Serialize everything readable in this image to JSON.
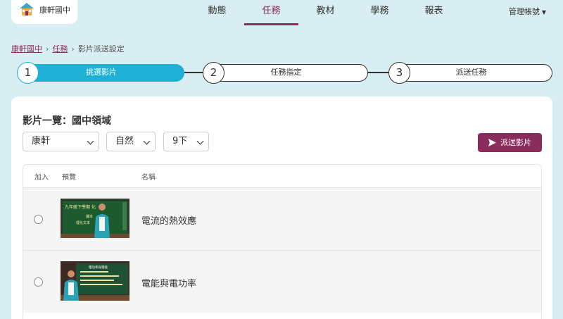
{
  "header": {
    "logo_text": "康軒國中",
    "nav": [
      {
        "label": "動態",
        "active": false
      },
      {
        "label": "任務",
        "active": true
      },
      {
        "label": "教材",
        "active": false
      },
      {
        "label": "學務",
        "active": false
      },
      {
        "label": "報表",
        "active": false
      }
    ],
    "account_label": "管理帳號"
  },
  "breadcrumb": {
    "items": [
      "康軒國中",
      "任務",
      "影片派送設定"
    ]
  },
  "steps": [
    {
      "number": "1",
      "label": "挑選影片",
      "active": true
    },
    {
      "number": "2",
      "label": "任務指定",
      "active": false
    },
    {
      "number": "3",
      "label": "派送任務",
      "active": false
    }
  ],
  "card": {
    "title": "影片一覽：國中領域",
    "filters": {
      "publisher": "康軒",
      "subject": "自然",
      "grade": "9下"
    },
    "send_label": "派送影片"
  },
  "table": {
    "headers": {
      "add": "加入",
      "preview": "預覽",
      "name": "名稱"
    },
    "rows": [
      {
        "name": "電流的熱效應",
        "thumb_text": "九年級下學期 化",
        "thumb_sub": "課本",
        "thumb_sub2": "理化文本"
      },
      {
        "name": "電能與電功率",
        "thumb_text": "電功率與電能",
        "thumb_sub": "",
        "thumb_sub2": ""
      }
    ]
  },
  "colors": {
    "accent": "#8b2d5c",
    "step_active": "#1eb1d5",
    "background": "#d8eef2"
  }
}
